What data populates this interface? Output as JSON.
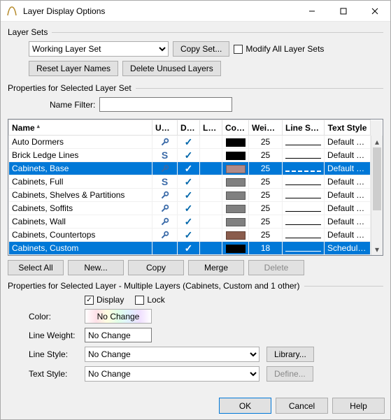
{
  "window": {
    "title": "Layer Display Options"
  },
  "layersets": {
    "caption": "Layer Sets",
    "working": "Working Layer Set",
    "copyset": "Copy Set...",
    "modifyall": "Modify All Layer Sets",
    "reset": "Reset Layer Names",
    "delete_unused": "Delete Unused Layers"
  },
  "selectedset": {
    "caption": "Properties for Selected Layer Set",
    "namefilter_label": "Name Filter:",
    "namefilter_value": ""
  },
  "grid": {
    "cols": {
      "name": "Name",
      "used": "Used",
      "disp": "Disp",
      "lock": "Lock",
      "color": "Color",
      "weight": "Weight",
      "linestyle": "Line Style",
      "textstyle": "Text Style"
    },
    "rows": [
      {
        "name": "Auto Dormers",
        "used": "wrench",
        "disp": true,
        "lock": false,
        "color": "#000000",
        "weight": "25",
        "line": "solid",
        "text": "Default Te...",
        "sel": false
      },
      {
        "name": "Brick Ledge Lines",
        "used": "S",
        "disp": true,
        "lock": false,
        "color": "#000000",
        "weight": "25",
        "line": "solid",
        "text": "Default Te...",
        "sel": false
      },
      {
        "name": "Cabinets,  Base",
        "used": "wrench",
        "disp": true,
        "lock": false,
        "color": "#b08a88",
        "weight": "25",
        "line": "dashed",
        "text": "Default Te...",
        "sel": true
      },
      {
        "name": "Cabinets,  Full",
        "used": "S",
        "disp": true,
        "lock": false,
        "color": "#808080",
        "weight": "25",
        "line": "solid",
        "text": "Default Te...",
        "sel": false
      },
      {
        "name": "Cabinets,  Shelves & Partitions",
        "used": "wrench",
        "disp": true,
        "lock": false,
        "color": "#808080",
        "weight": "25",
        "line": "solid",
        "text": "Default Te...",
        "sel": false
      },
      {
        "name": "Cabinets,  Soffits",
        "used": "wrench",
        "disp": true,
        "lock": false,
        "color": "#808080",
        "weight": "25",
        "line": "solid",
        "text": "Default Te...",
        "sel": false
      },
      {
        "name": "Cabinets,  Wall",
        "used": "wrench",
        "disp": true,
        "lock": false,
        "color": "#808080",
        "weight": "25",
        "line": "solid",
        "text": "Default Te...",
        "sel": false
      },
      {
        "name": "Cabinets, Countertops",
        "used": "wrench",
        "disp": true,
        "lock": false,
        "color": "#8a5c4c",
        "weight": "25",
        "line": "solid",
        "text": "Default Te...",
        "sel": false
      },
      {
        "name": "Cabinets, Custom",
        "used": "",
        "disp": true,
        "lock": false,
        "color": "#000000",
        "weight": "18",
        "line": "solid",
        "text": "Schedule ...",
        "sel": true
      }
    ]
  },
  "gridbtns": {
    "selectall": "Select All",
    "new": "New...",
    "copy": "Copy",
    "merge": "Merge",
    "delete": "Delete"
  },
  "layerprops": {
    "caption": "Properties for Selected Layer - Multiple Layers (Cabinets, Custom and 1 other)",
    "display_label": "Display",
    "display_checked": true,
    "lock_label": "Lock",
    "lock_checked": false,
    "color_label": "Color:",
    "color_value": "No Change",
    "lineweight_label": "Line Weight:",
    "lineweight_value": "No Change",
    "linestyle_label": "Line Style:",
    "linestyle_value": "No Change",
    "textstyle_label": "Text Style:",
    "textstyle_value": "No Change",
    "library": "Library...",
    "define": "Define..."
  },
  "footer": {
    "ok": "OK",
    "cancel": "Cancel",
    "help": "Help"
  }
}
